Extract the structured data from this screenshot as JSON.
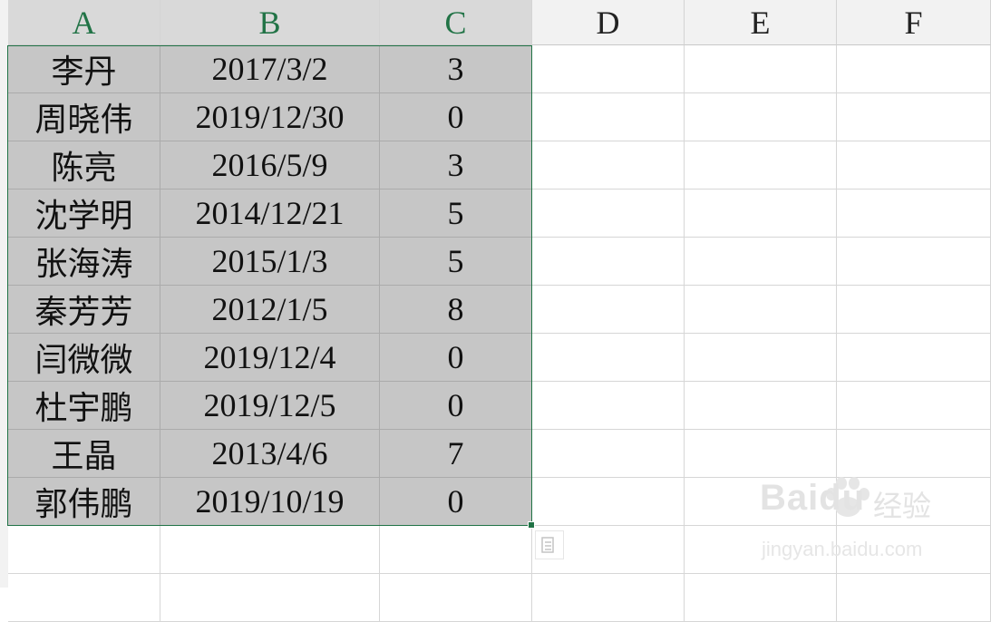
{
  "columns": [
    "A",
    "B",
    "C",
    "D",
    "E",
    "F"
  ],
  "rows": [
    [
      "李丹",
      "2017/3/2",
      "3"
    ],
    [
      "周晓伟",
      "2019/12/30",
      "0"
    ],
    [
      "陈亮",
      "2016/5/9",
      "3"
    ],
    [
      "沈学明",
      "2014/12/21",
      "5"
    ],
    [
      "张海涛",
      "2015/1/3",
      "5"
    ],
    [
      "秦芳芳",
      "2012/1/5",
      "8"
    ],
    [
      "闫微微",
      "2019/12/4",
      "0"
    ],
    [
      "杜宇鹏",
      "2019/12/5",
      "0"
    ],
    [
      "王晶",
      "2013/4/6",
      "7"
    ],
    [
      "郭伟鹏",
      "2019/10/19",
      "0"
    ]
  ],
  "selection": {
    "range": "A1:C10",
    "accent_color": "#217346",
    "fill_color": "#c6c6c6"
  },
  "watermark": {
    "brand": "Baidu",
    "cn_text": "经验",
    "url": "jingyan.baidu.com"
  },
  "icons": {
    "quick_analysis": "quick-analysis-icon",
    "paw": "baidu-paw-icon"
  }
}
